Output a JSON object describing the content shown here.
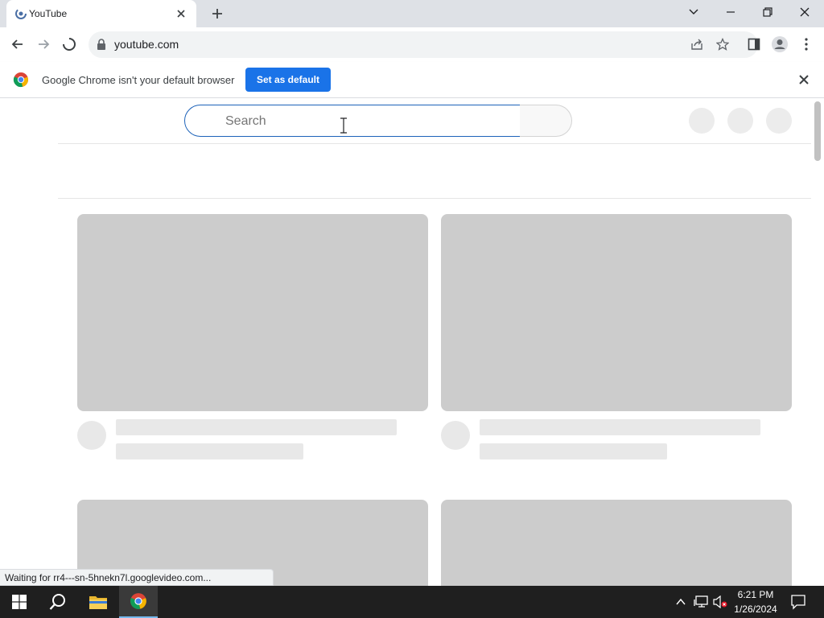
{
  "browser": {
    "tab_title": "YouTube",
    "url": "youtube.com",
    "infobar_message": "Google Chrome isn't your default browser",
    "infobar_button": "Set as default",
    "status_text": "Waiting for rr4---sn-5hnekn7l.googlevideo.com..."
  },
  "youtube": {
    "search_placeholder": "Search"
  },
  "taskbar": {
    "time": "6:21 PM",
    "date": "1/26/2024"
  },
  "icons": {
    "tab_favicon": "youtube-loading-icon",
    "tab_close": "close-icon",
    "new_tab": "plus-icon",
    "back": "arrow-left-icon",
    "forward": "arrow-right-icon",
    "reload": "loading-spinner-icon",
    "secure": "lock-icon",
    "share": "share-icon",
    "bookmark": "star-icon",
    "side_panel": "side-panel-icon",
    "profile": "profile-icon",
    "menu": "kebab-menu-icon"
  },
  "colors": {
    "accent_blue": "#1a73e8",
    "skeleton_thumb": "#cccccc",
    "skeleton_text": "#e8e8e8",
    "taskbar": "#1f1f1f"
  }
}
